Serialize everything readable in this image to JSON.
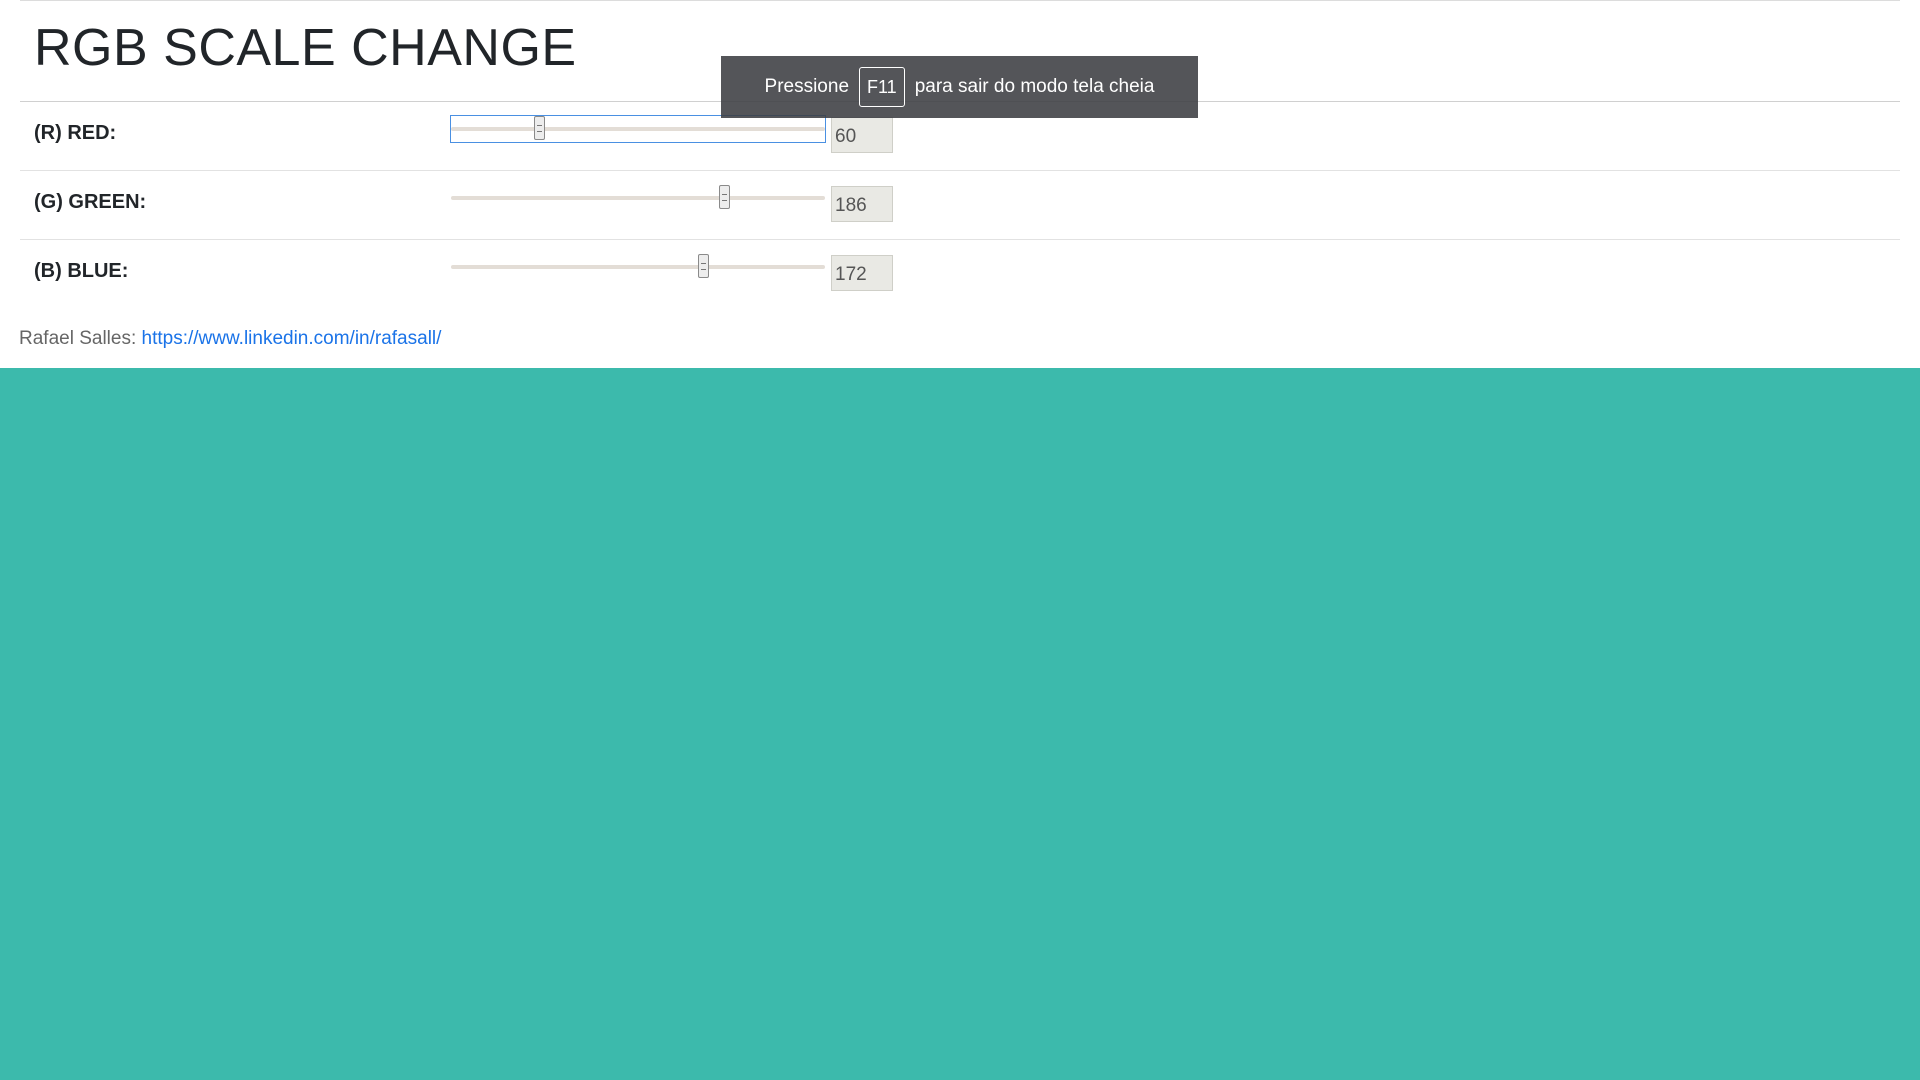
{
  "page": {
    "title": "RGB SCALE CHANGE"
  },
  "controls": [
    {
      "label": "(R) RED:",
      "value": 60,
      "value_text": "60",
      "min": 0,
      "max": 255,
      "focused": true
    },
    {
      "label": "(G) GREEN:",
      "value": 186,
      "value_text": "186",
      "min": 0,
      "max": 255,
      "focused": false
    },
    {
      "label": "(B) BLUE:",
      "value": 172,
      "value_text": "172",
      "min": 0,
      "max": 255,
      "focused": false
    }
  ],
  "credit": {
    "prefix": "Rafael Salles:",
    "link_text": "https://www.linkedin.com/in/rafasall/"
  },
  "preview": {
    "color": "#3cbaac"
  },
  "fullscreen_toast": {
    "before": "Pressione",
    "key": "F11",
    "after": "para sair do modo tela cheia"
  }
}
